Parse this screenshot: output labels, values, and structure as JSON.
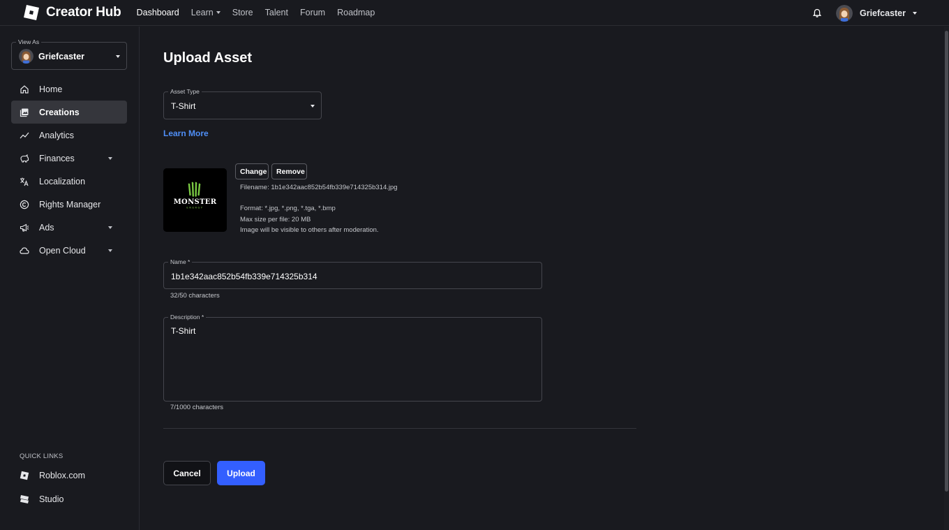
{
  "app": {
    "brand": "Creator Hub",
    "nav": [
      {
        "label": "Dashboard",
        "active": true,
        "dropdown": false
      },
      {
        "label": "Learn",
        "active": false,
        "dropdown": true
      },
      {
        "label": "Store",
        "active": false,
        "dropdown": false
      },
      {
        "label": "Talent",
        "active": false,
        "dropdown": false
      },
      {
        "label": "Forum",
        "active": false,
        "dropdown": false
      },
      {
        "label": "Roadmap",
        "active": false,
        "dropdown": false
      }
    ],
    "user": {
      "name": "Griefcaster"
    },
    "icons": {
      "notifications": "bell-icon",
      "brand": "roblox-logo-icon"
    }
  },
  "sidebar": {
    "view_as_label": "View As",
    "view_as_name": "Griefcaster",
    "items": [
      {
        "label": "Home",
        "icon": "home-icon",
        "active": false,
        "dropdown": false
      },
      {
        "label": "Creations",
        "icon": "creations-icon",
        "active": true,
        "dropdown": false
      },
      {
        "label": "Analytics",
        "icon": "analytics-icon",
        "active": false,
        "dropdown": false
      },
      {
        "label": "Finances",
        "icon": "piggy-bank-icon",
        "active": false,
        "dropdown": true
      },
      {
        "label": "Localization",
        "icon": "translate-icon",
        "active": false,
        "dropdown": false
      },
      {
        "label": "Rights Manager",
        "icon": "copyright-icon",
        "active": false,
        "dropdown": false
      },
      {
        "label": "Ads",
        "icon": "megaphone-icon",
        "active": false,
        "dropdown": true
      },
      {
        "label": "Open Cloud",
        "icon": "cloud-icon",
        "active": false,
        "dropdown": true
      }
    ],
    "quick_links_title": "QUICK LINKS",
    "quick_links": [
      {
        "label": "Roblox.com",
        "icon": "roblox-icon"
      },
      {
        "label": "Studio",
        "icon": "studio-icon"
      }
    ]
  },
  "main": {
    "title": "Upload Asset",
    "asset_type": {
      "label": "Asset Type",
      "value": "T-Shirt"
    },
    "learn_more": "Learn More",
    "file": {
      "change_label": "Change",
      "remove_label": "Remove",
      "filename": "Filename: 1b1e342aac852b54fb339e714325b314.jpg",
      "format": "Format: *.jpg, *.png, *.tga, *.bmp",
      "max_size": "Max size per file: 20 MB",
      "moderation": "Image will be visible to others after moderation.",
      "thumbnail_text": "MONSTER",
      "thumbnail_subtext": "ENERGY"
    },
    "name_field": {
      "label": "Name *",
      "value": "1b1e342aac852b54fb339e714325b314",
      "counter": "32/50 characters"
    },
    "description_field": {
      "label": "Description *",
      "value": "T-Shirt",
      "counter": "7/1000 characters"
    },
    "cancel_label": "Cancel",
    "upload_label": "Upload"
  },
  "colors": {
    "background": "#191a1f",
    "primary": "#335fff",
    "link": "#4f8ff7",
    "active_item": "#35363c",
    "monster_green": "#7ac943"
  }
}
